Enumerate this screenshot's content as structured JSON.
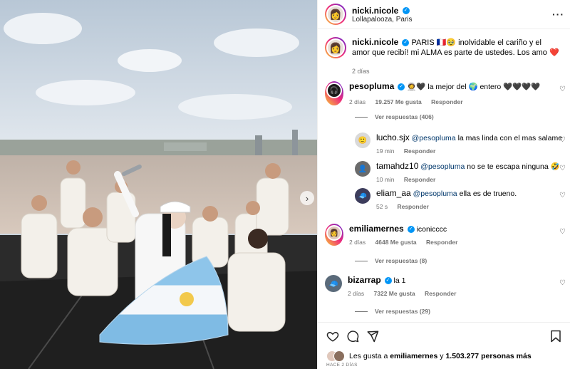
{
  "post": {
    "author": "nicki.nicole",
    "location": "Lollapalooza, Paris",
    "caption_author": "nicki.nicole",
    "caption_text": "PARIS 🇫🇷🥹 inolvidable el cariño y el amor que recibí! mi ALMA es parte de ustedes. Los amo ❤️",
    "caption_time": "2 días"
  },
  "comments": [
    {
      "user": "pesopluma",
      "verified": true,
      "text": "👩‍🚀🖤 la mejor del 🌍 entero 🖤🖤🖤🖤",
      "time": "2 días",
      "likes": "19.257 Me gusta",
      "reply": "Responder",
      "replies_label": "Ver respuestas (406)"
    },
    {
      "user": "lucho.sjx",
      "mention": "@pesopluma",
      "text": "la mas linda con el mas salame",
      "time": "19 min",
      "reply": "Responder"
    },
    {
      "user": "tamahdz10",
      "mention": "@pesopluma",
      "text": "no se te escapa ninguna 🤣",
      "time": "10 min",
      "reply": "Responder"
    },
    {
      "user": "eliam_aa",
      "mention": "@pesopluma",
      "text": "ella es de trueno.",
      "time": "52 s",
      "reply": "Responder"
    },
    {
      "user": "emiliamernes",
      "verified": true,
      "text": "iconicccc",
      "time": "2 días",
      "likes": "4648 Me gusta",
      "reply": "Responder",
      "replies_label": "Ver respuestas (8)"
    },
    {
      "user": "bizarrap",
      "verified": true,
      "text": "la 1",
      "time": "2 días",
      "likes": "7322 Me gusta",
      "reply": "Responder",
      "replies_label": "Ver respuestas (29)"
    }
  ],
  "likes_summary": {
    "prefix": "Les gusta a",
    "user": "emiliamernes",
    "and": "y",
    "count": "1.503.277 personas más"
  },
  "posted_ago": "HACE 2 DÍAS",
  "icons": [
    "heart-icon",
    "comment-icon",
    "share-icon",
    "bookmark-icon",
    "more-icon",
    "verified-icon",
    "next-icon"
  ],
  "colors": {
    "link": "#00376b",
    "verified": "#0095f6",
    "muted": "#737373"
  }
}
